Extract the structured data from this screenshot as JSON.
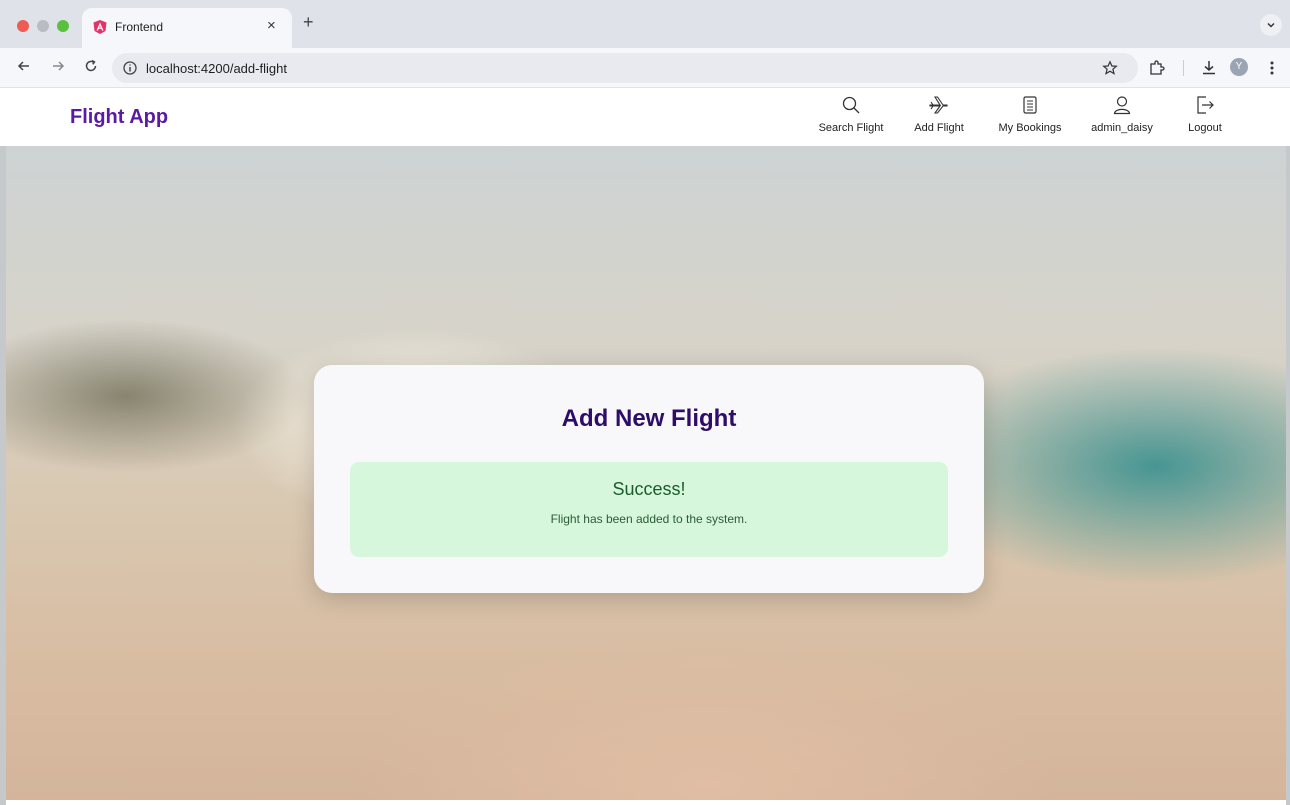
{
  "browser": {
    "tab_title": "Frontend",
    "new_tab_glyph": "+",
    "close_glyph": "×",
    "url": "localhost:4200/add-flight",
    "profile_initial": "Y",
    "icons": [
      "back-arrow-icon",
      "forward-arrow-icon",
      "reload-icon",
      "site-info-icon",
      "star-icon",
      "extensions-icon",
      "download-icon",
      "menu-icon"
    ]
  },
  "header": {
    "brand": "Flight App",
    "brand_color": "#5b1aa3",
    "nav": [
      {
        "label": "Search Flight",
        "icon": "search-icon"
      },
      {
        "label": "Add Flight",
        "icon": "airplane-icon"
      },
      {
        "label": "My Bookings",
        "icon": "bookings-icon"
      },
      {
        "label": "admin_daisy",
        "icon": "user-icon"
      },
      {
        "label": "Logout",
        "icon": "logout-icon"
      }
    ]
  },
  "card": {
    "title": "Add New Flight",
    "title_color": "#2e0c6a",
    "alert": {
      "title": "Success!",
      "message": "Flight has been added to the system.",
      "background": "#d7f7dd"
    }
  }
}
